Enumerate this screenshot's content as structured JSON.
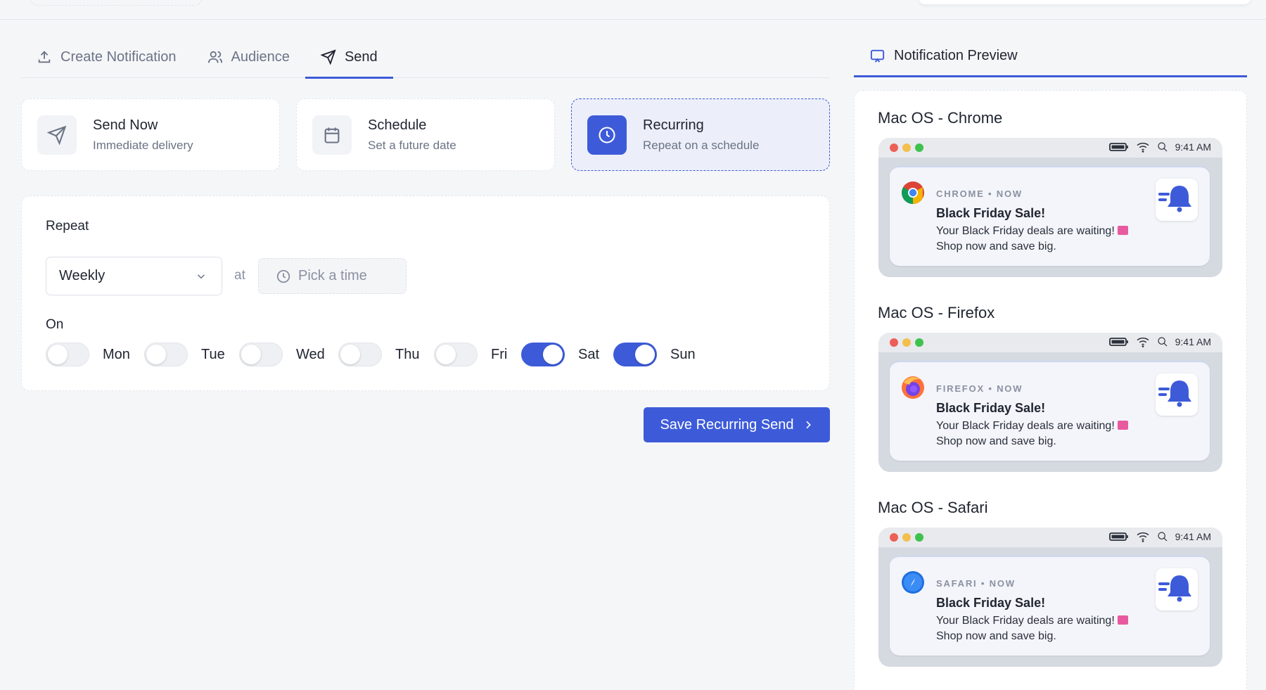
{
  "tabs": [
    {
      "label": "Create Notification",
      "icon": "upload-icon",
      "active": false
    },
    {
      "label": "Audience",
      "icon": "users-icon",
      "active": false
    },
    {
      "label": "Send",
      "icon": "send-icon",
      "active": true
    }
  ],
  "modes": [
    {
      "title": "Send Now",
      "subtitle": "Immediate delivery",
      "icon": "send-icon",
      "selected": false
    },
    {
      "title": "Schedule",
      "subtitle": "Set a future date",
      "icon": "calendar-icon",
      "selected": false
    },
    {
      "title": "Recurring",
      "subtitle": "Repeat on a schedule",
      "icon": "clock-icon",
      "selected": true
    }
  ],
  "repeat": {
    "label": "Repeat",
    "frequency": "Weekly",
    "at_label": "at",
    "time_placeholder": "Pick a time",
    "on_label": "On",
    "days": [
      {
        "label": "Mon",
        "on": false
      },
      {
        "label": "Tue",
        "on": false
      },
      {
        "label": "Wed",
        "on": false
      },
      {
        "label": "Thu",
        "on": false
      },
      {
        "label": "Fri",
        "on": false
      },
      {
        "label": "Sat",
        "on": true
      },
      {
        "label": "Sun",
        "on": true
      }
    ]
  },
  "save_button": {
    "label": "Save Recurring Send"
  },
  "preview": {
    "tab_label": "Notification Preview",
    "clock": "9:41 AM",
    "items": [
      {
        "title": "Mac OS - Chrome",
        "source": "CHROME • NOW",
        "browser_icon": "chrome-icon"
      },
      {
        "title": "Mac OS - Firefox",
        "source": "FIREFOX • NOW",
        "browser_icon": "firefox-icon"
      },
      {
        "title": "Mac OS - Safari",
        "source": "SAFARI • NOW",
        "browser_icon": "safari-icon"
      }
    ],
    "notification": {
      "title": "Black Friday Sale!",
      "body_line1": "Your Black Friday deals are waiting!",
      "body_line2": "Shop now and save big."
    }
  },
  "colors": {
    "accent": "#3d5bd9",
    "background": "#f5f6f8",
    "traffic_red": "#ec5f57",
    "traffic_yellow": "#f4bf4f",
    "traffic_green": "#3ec24d"
  }
}
